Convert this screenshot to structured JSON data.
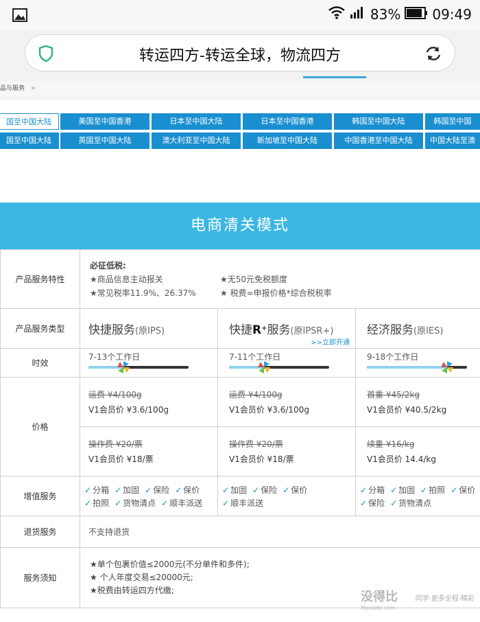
{
  "status_bar": {
    "battery_percent": "83%",
    "time": "09:49",
    "icons": [
      "image-notification-icon",
      "wifi-icon",
      "signal-icon",
      "battery-icon"
    ]
  },
  "url_bar": {
    "title": "转运四方-转运全球，物流四方",
    "icons": [
      "shield-icon",
      "reload-icon"
    ]
  },
  "breadcrumb": {
    "text": "品与服务",
    "separator": ">"
  },
  "route_tabs": {
    "row1": [
      "国至中国大陆",
      "美国至中国香港",
      "日本至中国大陆",
      "日本至中国香港",
      "韩国至中国大陆",
      "韩国至中国"
    ],
    "row2": [
      "国至中国大陆",
      "英国至中国大陆",
      "澳大利亚至中国大陆",
      "新加坡至中国大陆",
      "中国香港至中国大陆",
      "中国大陆至澳"
    ]
  },
  "banner": {
    "title": "电商清关模式"
  },
  "table": {
    "features": {
      "label": "产品服务特性",
      "heading": "必征低税:",
      "items": [
        "★商品信息主动报关",
        "★无50元免税额度",
        "★常见税率11.9%、26.37%",
        "★ 税费=申报价格*综合税税率"
      ]
    },
    "service_type": {
      "label": "产品服务类型",
      "services": [
        {
          "name": "快捷服务",
          "orig": "(原IPS)"
        },
        {
          "name_pre": "快捷",
          "name_r": "R",
          "name_sup": "+",
          "name_post": "服务",
          "orig": "(原IPSR+)",
          "link": ">>立即开通"
        },
        {
          "name": "经济服务",
          "orig": "(原IES)"
        }
      ]
    },
    "timeliness": {
      "label": "时效",
      "values": [
        "7-13个工作日",
        "7-11个工作日",
        "9-18个工作日"
      ],
      "progress": [
        0.35,
        0.35,
        0.8
      ]
    },
    "price": {
      "label": "价格",
      "row1": [
        {
          "orig": "运费 ¥4/100g",
          "member": "V1会员价 ¥3.6/100g"
        },
        {
          "orig": "运费 ¥4/100g",
          "member": "V1会员价 ¥3.6/100g"
        },
        {
          "orig": "首重 ¥45/2kg",
          "member": "V1会员价 ¥40.5/2kg"
        }
      ],
      "row2": [
        {
          "orig": "操作费 ¥20/票",
          "member": "V1会员价 ¥18/票"
        },
        {
          "orig": "操作费 ¥20/票",
          "member": "V1会员价 ¥18/票"
        },
        {
          "orig": "续重 ¥16/kg",
          "member": "V1会员价 14.4/kg"
        }
      ]
    },
    "value_added": {
      "label": "增值服务",
      "col1": [
        "分箱",
        "加固",
        "保险",
        "保价",
        "拍照",
        "货物清点",
        "顺丰派送"
      ],
      "col2": [
        "加固",
        "保险",
        "保价",
        "顺丰派送"
      ],
      "col3": [
        "分箱",
        "加固",
        "拍照",
        "保价",
        "保险",
        "货物清点"
      ]
    },
    "refund": {
      "label": "退货服务",
      "value": "不支持退货"
    },
    "notice": {
      "label": "服务须知",
      "items": [
        "★单个包裹价值≤2000元(不分单件和多件);",
        "★ 个人年度交易≤20000元;",
        "★税费由转运四方代缴;"
      ]
    }
  },
  "watermark": {
    "brand": "没得比",
    "domain": "Meidebi.com",
    "overlay": "同学·更多全程·精彩"
  },
  "colors": {
    "accent": "#1a8fd0",
    "banner": "#3cb6e2",
    "tick": "#1a8fd0"
  }
}
